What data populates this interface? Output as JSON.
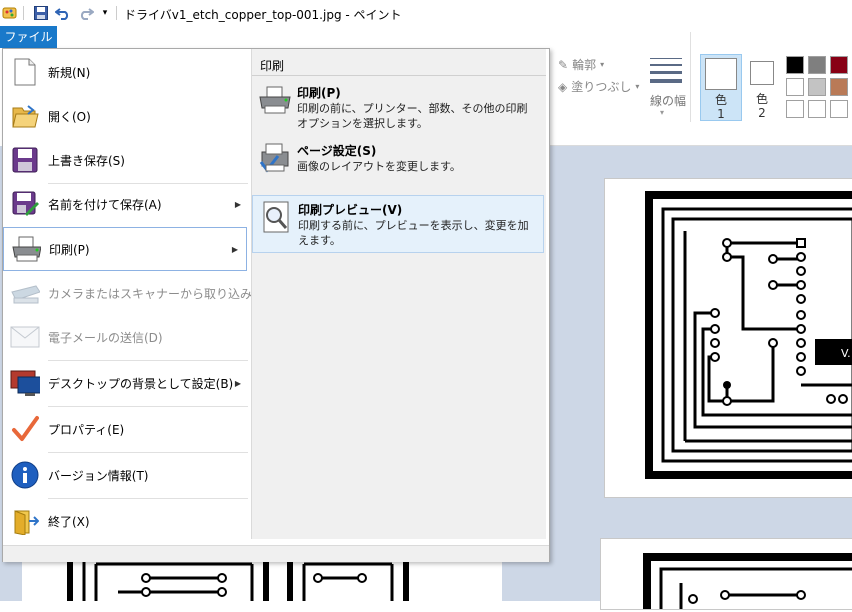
{
  "window": {
    "title": "ドライバv1_etch_copper_top-001.jpg - ペイント"
  },
  "quick_access": {
    "icons": [
      "paint-app-icon",
      "save-icon",
      "undo-icon",
      "redo-icon",
      "customize-dropdown-icon"
    ]
  },
  "file_tab": {
    "label": "ファイル"
  },
  "file_menu": {
    "items": [
      {
        "label": "新規(N)",
        "icon": "new-document-icon",
        "enabled": true,
        "has_submenu": false
      },
      {
        "label": "開く(O)",
        "icon": "open-folder-icon",
        "enabled": true,
        "has_submenu": false
      },
      {
        "label": "上書き保存(S)",
        "icon": "save-icon",
        "enabled": true,
        "has_submenu": false
      },
      {
        "label": "名前を付けて保存(A)",
        "icon": "save-as-icon",
        "enabled": true,
        "has_submenu": true
      },
      {
        "label": "印刷(P)",
        "icon": "printer-icon",
        "enabled": true,
        "has_submenu": true,
        "selected": true
      },
      {
        "label": "カメラまたはスキャナーから取り込み(M)",
        "icon": "scanner-icon",
        "enabled": false,
        "has_submenu": false
      },
      {
        "label": "電子メールの送信(D)",
        "icon": "email-icon",
        "enabled": false,
        "has_submenu": false
      },
      {
        "label": "デスクトップの背景として設定(B)",
        "icon": "desktop-background-icon",
        "enabled": true,
        "has_submenu": true
      },
      {
        "label": "プロパティ(E)",
        "icon": "checkmark-icon",
        "enabled": true,
        "has_submenu": false
      },
      {
        "label": "バージョン情報(T)",
        "icon": "info-icon",
        "enabled": true,
        "has_submenu": false
      },
      {
        "label": "終了(X)",
        "icon": "exit-icon",
        "enabled": true,
        "has_submenu": false
      }
    ]
  },
  "print_submenu": {
    "header": "印刷",
    "items": [
      {
        "title": "印刷(P)",
        "description": "印刷の前に、プリンター、部数、その他の印刷オプションを選択します。",
        "icon": "printer-icon"
      },
      {
        "title": "ページ設定(S)",
        "description": "画像のレイアウトを変更します。",
        "icon": "page-setup-icon"
      },
      {
        "title": "印刷プレビュー(V)",
        "description": "印刷する前に、プレビューを表示し、変更を加えます。",
        "icon": "print-preview-icon",
        "highlighted": true
      }
    ]
  },
  "ribbon": {
    "outline_label": "輪郭",
    "fill_label": "塗りつぶし",
    "line_width_label": "線の幅",
    "color1_label": "色\n1",
    "color1_line1": "色",
    "color1_line2": "1",
    "color2_line1": "色",
    "color2_line2": "2",
    "palette_colors": [
      "#000000",
      "#7f7f7f",
      "#880015",
      "#ffffff",
      "#c3c3c3",
      "#b97a57",
      "#ffffff",
      "#ffffff",
      "#ffffff"
    ]
  },
  "canvas_text": {
    "label": "V."
  },
  "colors": {
    "accent": "#1979ca",
    "selected_border": "#8db2e3",
    "highlight_bg": "#e5f1fb"
  }
}
